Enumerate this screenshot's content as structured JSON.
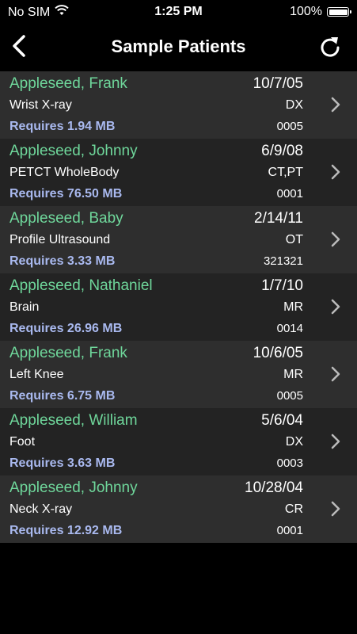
{
  "status_bar": {
    "carrier": "No SIM",
    "time": "1:25 PM",
    "battery": "100%"
  },
  "nav": {
    "title": "Sample Patients",
    "back_icon": "chevron-left-icon",
    "refresh_icon": "refresh-icon"
  },
  "colors": {
    "name": "#6fd79b",
    "size": "#a9b9ef",
    "row_odd": "#2e2e2e",
    "row_even": "#232323"
  },
  "patients": [
    {
      "name": "Appleseed, Frank",
      "date": "10/7/05",
      "study": "Wrist X-ray",
      "modality": "DX",
      "size": "Requires 1.94 MB",
      "number": "0005"
    },
    {
      "name": "Appleseed, Johnny",
      "date": "6/9/08",
      "study": "PETCT WholeBody",
      "modality": "CT,PT",
      "size": "Requires 76.50 MB",
      "number": "0001"
    },
    {
      "name": "Appleseed, Baby",
      "date": "2/14/11",
      "study": "Profile Ultrasound",
      "modality": "OT",
      "size": "Requires 3.33 MB",
      "number": "321321"
    },
    {
      "name": "Appleseed, Nathaniel",
      "date": "1/7/10",
      "study": "Brain",
      "modality": "MR",
      "size": "Requires 26.96 MB",
      "number": "0014"
    },
    {
      "name": "Appleseed, Frank",
      "date": "10/6/05",
      "study": "Left Knee",
      "modality": "MR",
      "size": "Requires 6.75 MB",
      "number": "0005"
    },
    {
      "name": "Appleseed, William",
      "date": "5/6/04",
      "study": "Foot",
      "modality": "DX",
      "size": "Requires 3.63 MB",
      "number": "0003"
    },
    {
      "name": "Appleseed, Johnny",
      "date": "10/28/04",
      "study": "Neck X-ray",
      "modality": "CR",
      "size": "Requires 12.92 MB",
      "number": "0001"
    }
  ]
}
